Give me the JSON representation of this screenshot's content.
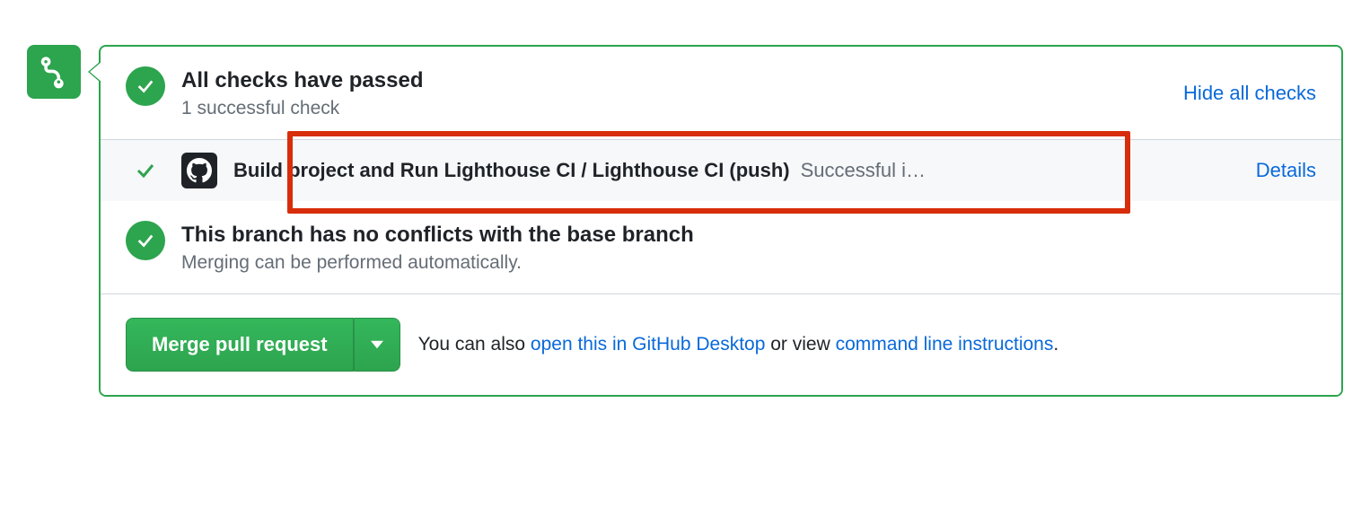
{
  "checks": {
    "title": "All checks have passed",
    "subtitle": "1 successful check",
    "toggle_link": "Hide all checks",
    "items": [
      {
        "name": "Build project and Run Lighthouse CI / Lighthouse CI (push)",
        "status": "Successful i…",
        "details_link": "Details"
      }
    ]
  },
  "conflicts": {
    "title": "This branch has no conflicts with the base branch",
    "subtitle": "Merging can be performed automatically."
  },
  "footer": {
    "merge_label": "Merge pull request",
    "text_prefix": "You can also ",
    "link_desktop": "open this in GitHub Desktop",
    "text_mid": " or view ",
    "link_cmdline": "command line instructions",
    "text_suffix": "."
  }
}
